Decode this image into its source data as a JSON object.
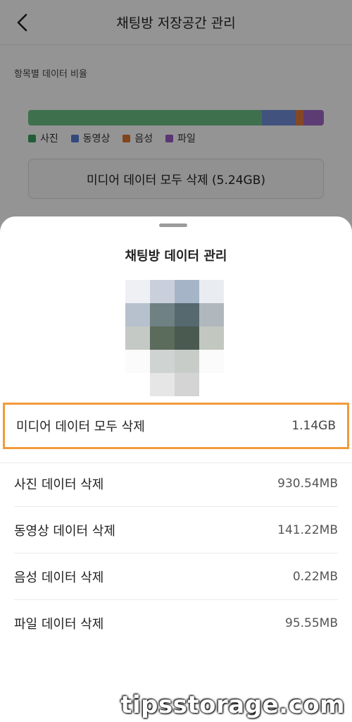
{
  "header": {
    "title": "채팅방 저장공간 관리",
    "back_icon": "chevron-left-icon"
  },
  "section_label": "항목별 데이터 비율",
  "storage_bar": {
    "segments": [
      {
        "name": "사진",
        "share": 0.79,
        "color": "#6cc187"
      },
      {
        "name": "동영상",
        "share": 0.115,
        "color": "#6f8ed8"
      },
      {
        "name": "음성",
        "share": 0.025,
        "color": "#e57d42"
      },
      {
        "name": "파일",
        "share": 0.07,
        "color": "#a168c9"
      }
    ]
  },
  "legend": [
    {
      "label": "사진",
      "color": "#3aa35f"
    },
    {
      "label": "동영상",
      "color": "#5a7fd6"
    },
    {
      "label": "음성",
      "color": "#e1752f"
    },
    {
      "label": "파일",
      "color": "#9a5cc6"
    }
  ],
  "media_delete_all_button": "미디어 데이터 모두 삭제 (5.24GB)",
  "sheet": {
    "title": "채팅방 데이터 관리",
    "highlight_row": {
      "label": "미디어 데이터 모두 삭제",
      "value": "1.14GB",
      "highlight_color": "#f29a3b"
    },
    "rows": [
      {
        "label": "사진 데이터 삭제",
        "value": "930.54MB"
      },
      {
        "label": "동영상 데이터 삭제",
        "value": "141.22MB"
      },
      {
        "label": "음성 데이터 삭제",
        "value": "0.22MB"
      },
      {
        "label": "파일 데이터 삭제",
        "value": "95.55MB"
      }
    ]
  },
  "watermark": "tipsstorage.com"
}
